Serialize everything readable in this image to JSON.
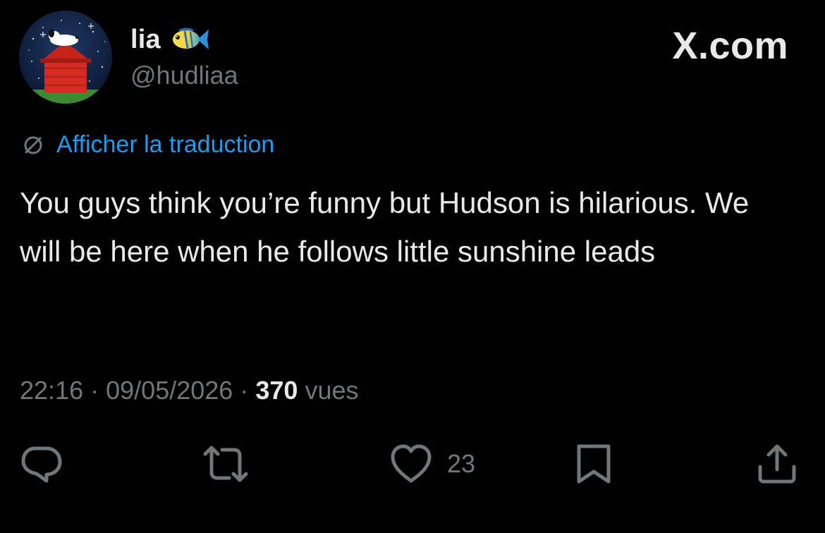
{
  "post": {
    "author": {
      "display_name": "lia",
      "handle": "@hudliaa",
      "emoji_icon": "tropical-fish-icon"
    },
    "brand": "X.com",
    "translate_label": "Afficher la traduction",
    "text": "You guys think you’re funny but Hudson is hilarious. We will be here when he follows little sunshine leads",
    "time": "22:16",
    "date": "09/05/2026",
    "separator": "·",
    "views_count": "370",
    "views_label": "vues",
    "actions": {
      "reply_icon": "reply-icon",
      "repost_icon": "repost-icon",
      "like_icon": "heart-icon",
      "like_count": "23",
      "bookmark_icon": "bookmark-icon",
      "share_icon": "share-icon"
    }
  },
  "colors": {
    "background": "#000000",
    "text_primary": "#e7e9ea",
    "text_secondary": "#71767b",
    "link_blue": "#1d9bf0"
  }
}
